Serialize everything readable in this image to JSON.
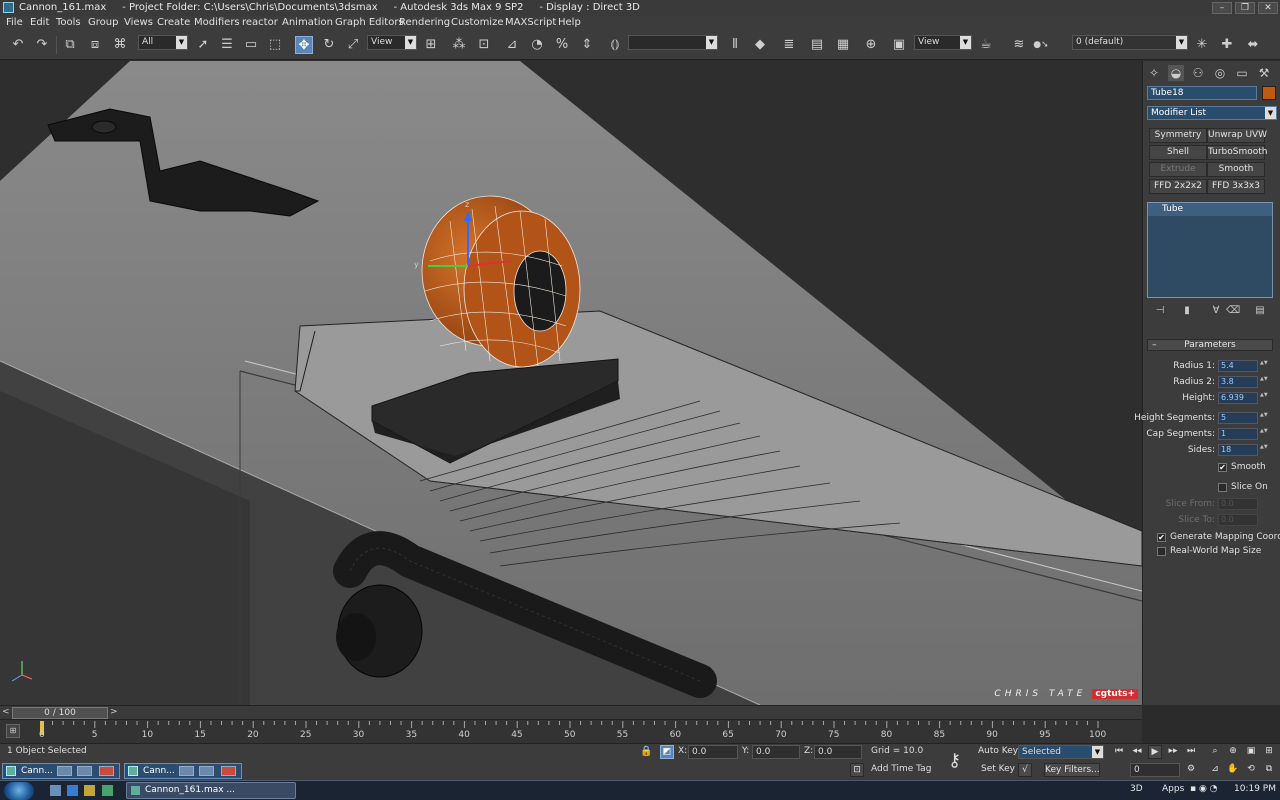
{
  "window": {
    "title": "Cannon_161.max     - Project Folder: C:\\Users\\Chris\\Documents\\3dsmax     - Autodesk 3ds Max 9 SP2     - Display : Direct 3D",
    "minimize": "–",
    "restore": "❐",
    "close": "✕"
  },
  "menu": [
    "File",
    "Edit",
    "Tools",
    "Group",
    "Views",
    "Create",
    "Modifiers",
    "reactor",
    "Animation",
    "Graph Editors",
    "Rendering",
    "Customize",
    "MAXScript",
    "Help"
  ],
  "toolbar": {
    "selection_filter": "All",
    "reference_coord": "View",
    "named_selection": "",
    "view_dropdown2": "View",
    "layer": "0 (default)"
  },
  "viewport": {
    "watermark_name": "CHRIS TATE",
    "watermark_brand": "cgtuts+",
    "axis_labels": {
      "x": "x",
      "y": "y",
      "z": "z"
    }
  },
  "command_panel": {
    "object_name": "Tube18",
    "object_color": "#c05a10",
    "modifier_list": "Modifier List",
    "modifier_buttons": [
      {
        "label": "Symmetry",
        "enabled": true
      },
      {
        "label": "Unwrap UVW",
        "enabled": true
      },
      {
        "label": "Shell",
        "enabled": true
      },
      {
        "label": "TurboSmooth",
        "enabled": true
      },
      {
        "label": "Extrude",
        "enabled": false
      },
      {
        "label": "Smooth",
        "enabled": true
      },
      {
        "label": "FFD 2x2x2",
        "enabled": true
      },
      {
        "label": "FFD 3x3x3",
        "enabled": true
      }
    ],
    "stack": [
      "Tube"
    ],
    "rollout_title": "Parameters",
    "rollout_toggle": "–",
    "params": [
      {
        "label": "Radius 1:",
        "value": "5.4",
        "enabled": true
      },
      {
        "label": "Radius 2:",
        "value": "3.8",
        "enabled": true
      },
      {
        "label": "Height:",
        "value": "6.939",
        "enabled": true
      },
      {
        "label": "Height Segments:",
        "value": "5",
        "enabled": true
      },
      {
        "label": "Cap Segments:",
        "value": "1",
        "enabled": true
      },
      {
        "label": "Sides:",
        "value": "18",
        "enabled": true
      }
    ],
    "smooth": {
      "label": "Smooth",
      "checked": true
    },
    "slice_on": {
      "label": "Slice On",
      "checked": false
    },
    "slice_params": [
      {
        "label": "Slice From:",
        "value": "0.0"
      },
      {
        "label": "Slice To:",
        "value": "0.0"
      }
    ],
    "gen_mapping": {
      "label": "Generate Mapping Coords.",
      "checked": true
    },
    "real_world": {
      "label": "Real-World Map Size",
      "checked": false
    }
  },
  "timeline": {
    "frame_display": "0 / 100",
    "prev": "<",
    "next": ">",
    "tick_labels": [
      "0",
      "5",
      "10",
      "15",
      "20",
      "25",
      "30",
      "35",
      "40",
      "45",
      "50",
      "55",
      "60",
      "65",
      "70",
      "75",
      "80",
      "85",
      "90",
      "95",
      "100"
    ],
    "frame_min": 0,
    "frame_max": 100,
    "current_frame": 0
  },
  "status": {
    "selection": "1 Object Selected",
    "x_label": "X:",
    "x_value": "0.0",
    "y_label": "Y:",
    "y_value": "0.0",
    "z_label": "Z:",
    "z_value": "0.0",
    "grid": "Grid = 10.0",
    "add_time_tag": "Add Time Tag",
    "auto_key": "Auto Key",
    "set_key": "Set Key",
    "selected_dropdown": "Selected",
    "key_filters": "Key Filters...",
    "frame_field": "0",
    "mini_windows": [
      "Cann...",
      "Cann..."
    ]
  },
  "taskbar": {
    "task": "Cannon_161.max ...",
    "tray_3d": "3D",
    "apps": "Apps",
    "clock": "10:19 PM"
  },
  "colors": {
    "accent": "#5b86b9",
    "tube": "#b8541a",
    "watermark_red": "#cf2f2f"
  }
}
